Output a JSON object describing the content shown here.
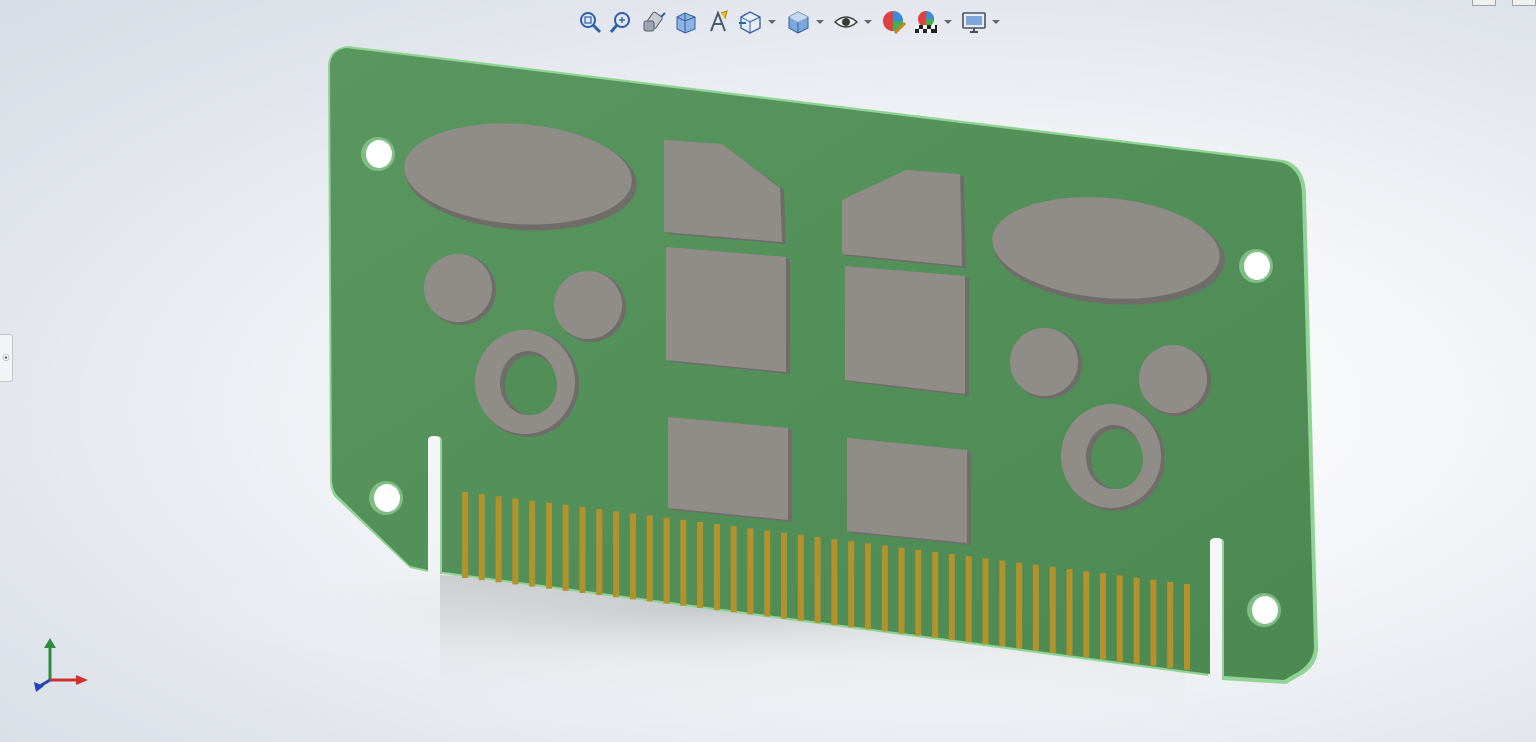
{
  "window": {
    "controls": [
      "minimize",
      "maximize"
    ]
  },
  "toolbar": {
    "items": [
      {
        "id": "zoom-to-fit",
        "icon": "zoom-to-fit-icon"
      },
      {
        "id": "zoom-to-area",
        "icon": "zoom-to-area-icon"
      },
      {
        "id": "previous-view",
        "icon": "previous-view-icon"
      },
      {
        "id": "section-view",
        "icon": "section-view-icon"
      },
      {
        "id": "dynamic-annotation-views",
        "icon": "annotation-view-icon"
      },
      {
        "id": "view-orientation",
        "icon": "view-orientation-icon",
        "dropdown": true
      },
      {
        "id": "display-style",
        "icon": "display-style-icon",
        "dropdown": true
      },
      {
        "id": "hide-show-items",
        "icon": "hide-show-eye-icon",
        "dropdown": true
      },
      {
        "id": "edit-appearance",
        "icon": "edit-appearance-icon"
      },
      {
        "id": "apply-scene",
        "icon": "apply-scene-icon",
        "dropdown": true
      },
      {
        "id": "view-settings",
        "icon": "view-settings-monitor-icon",
        "dropdown": true
      }
    ]
  },
  "left_panel_tab": {
    "glyph": "⦿"
  },
  "model": {
    "type": "pcb-edge-connector-card",
    "colors": {
      "board": "#528e57",
      "board_edge": "#8fd494",
      "component": "#8a8784",
      "component_top": "#908d89",
      "component_side": "#6f6d6a",
      "gold_finger": "#b3922b",
      "background": "#eef0f4"
    },
    "gold_finger_count": 44,
    "mounting_hole_count": 4
  },
  "triad": {
    "axes": [
      {
        "axis": "x",
        "color": "#d0312d"
      },
      {
        "axis": "y",
        "color": "#2e8b3a"
      },
      {
        "axis": "z",
        "color": "#2443b8"
      }
    ]
  }
}
